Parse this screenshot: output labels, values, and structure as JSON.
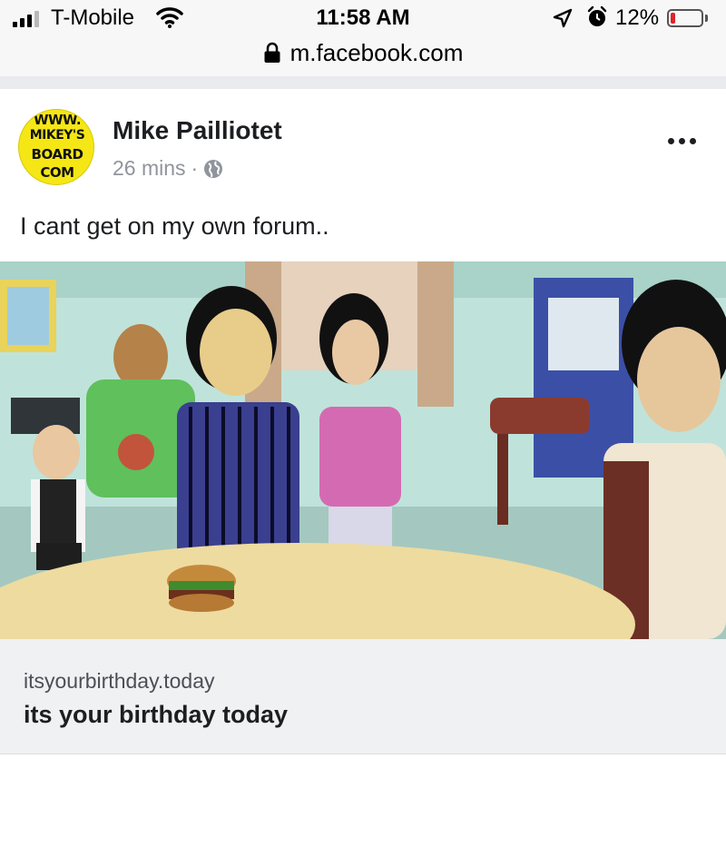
{
  "status_bar": {
    "carrier": "T-Mobile",
    "time": "11:58 AM",
    "battery_percent": "12%",
    "battery_level": 0.12,
    "icons": [
      "signal-icon",
      "wifi-icon",
      "location-icon",
      "alarm-icon",
      "battery-icon"
    ]
  },
  "browser": {
    "url": "m.facebook.com"
  },
  "post": {
    "avatar_lines": [
      "WWW.",
      "MIKEY'S",
      "BOARD",
      "COM"
    ],
    "author": "Mike Pailliotet",
    "timestamp": "26 mins",
    "separator": "·",
    "privacy_icon": "globe-icon",
    "text": "I cant get on my own forum..",
    "link": {
      "domain": "itsyourbirthday.today",
      "title": "its your birthday today"
    }
  },
  "colors": {
    "avatar_bg": "#f5e615",
    "feed_background": "#e9ebee",
    "caption_background": "#f0f1f3",
    "secondary_text": "#90949c",
    "battery_low": "#e0222a"
  }
}
